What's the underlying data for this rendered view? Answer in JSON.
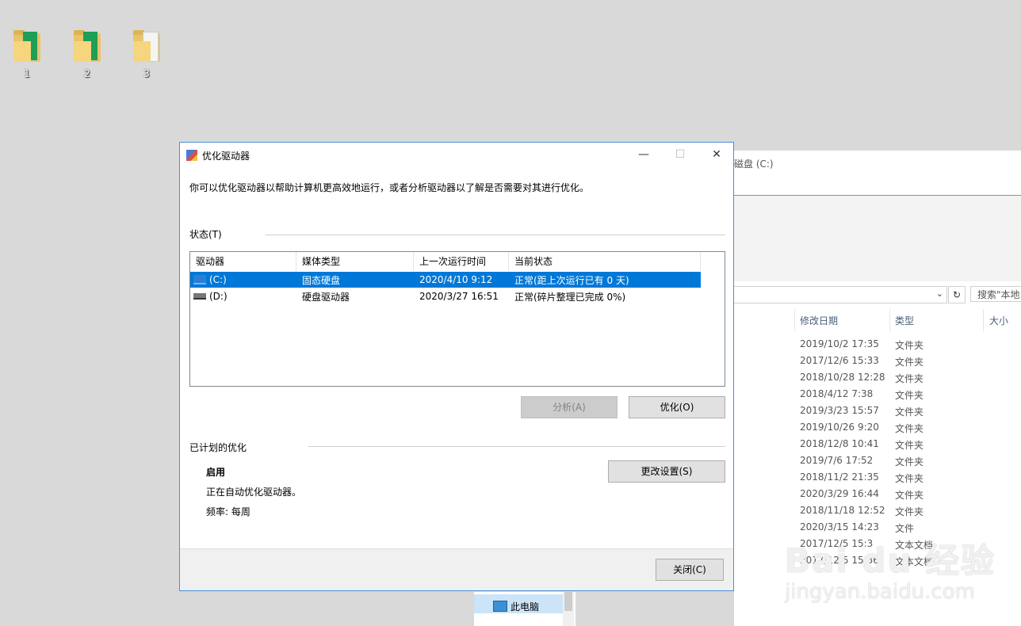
{
  "desktop": {
    "icons": [
      {
        "label": "1",
        "kind": "green-doc"
      },
      {
        "label": "2",
        "kind": "green-doc"
      },
      {
        "label": "3",
        "kind": "white-doc"
      }
    ]
  },
  "explorer": {
    "title": "磁盘 (C:)",
    "search_placeholder": "搜索\"本地",
    "columns": {
      "date": "修改日期",
      "type": "类型",
      "size": "大小"
    },
    "rows": [
      {
        "date": "2019/10/2 17:35",
        "type": "文件夹"
      },
      {
        "date": "2017/12/6 15:33",
        "type": "文件夹"
      },
      {
        "date": "2018/10/28 12:28",
        "type": "文件夹"
      },
      {
        "date": "2018/4/12 7:38",
        "type": "文件夹"
      },
      {
        "date": "2019/3/23 15:57",
        "type": "文件夹"
      },
      {
        "date": "2019/10/26 9:20",
        "type": "文件夹"
      },
      {
        "date": "2018/12/8 10:41",
        "type": "文件夹"
      },
      {
        "date": "2019/7/6 17:52",
        "type": "文件夹"
      },
      {
        "date": "2018/11/2 21:35",
        "type": "文件夹"
      },
      {
        "date": "2020/3/29 16:44",
        "type": "文件夹"
      },
      {
        "date": "2018/11/18 12:52",
        "type": "文件夹"
      },
      {
        "date": "2020/3/15 14:23",
        "type": "文件"
      },
      {
        "date": "2017/12/5 15:3",
        "type": "文本文档"
      },
      {
        "date": "2017/12/5 15:36",
        "type": "文本文档"
      }
    ],
    "nav_this_pc": "此电脑"
  },
  "dialog": {
    "title": "优化驱动器",
    "description": "你可以优化驱动器以帮助计算机更高效地运行，或者分析驱动器以了解是否需要对其进行优化。",
    "status_label": "状态(T)",
    "columns": [
      "驱动器",
      "媒体类型",
      "上一次运行时间",
      "当前状态"
    ],
    "drives": [
      {
        "name": "(C:)",
        "media": "固态硬盘",
        "last_run": "2020/4/10 9:12",
        "status": "正常(距上次运行已有 0 天)",
        "icon": "ssd-icon",
        "selected": true
      },
      {
        "name": "(D:)",
        "media": "硬盘驱动器",
        "last_run": "2020/3/27 16:51",
        "status": "正常(碎片整理已完成 0%)",
        "icon": "hdd-icon",
        "selected": false
      }
    ],
    "analyze_button": "分析(A)",
    "optimize_button": "优化(O)",
    "scheduled_label": "已计划的优化",
    "schedule_state": "启用",
    "schedule_desc": "正在自动优化驱动器。",
    "frequency": "频率: 每周",
    "change_settings_button": "更改设置(S)",
    "close_button": "关闭(C)",
    "window_controls": {
      "minimize": "—",
      "maximize": "☐",
      "close": "✕"
    }
  },
  "watermark": {
    "line1": "Bai du 经验",
    "line2": "jingyan.baidu.com"
  },
  "colors": {
    "selection": "#0078d7",
    "accent_border": "#4a8fd8"
  }
}
